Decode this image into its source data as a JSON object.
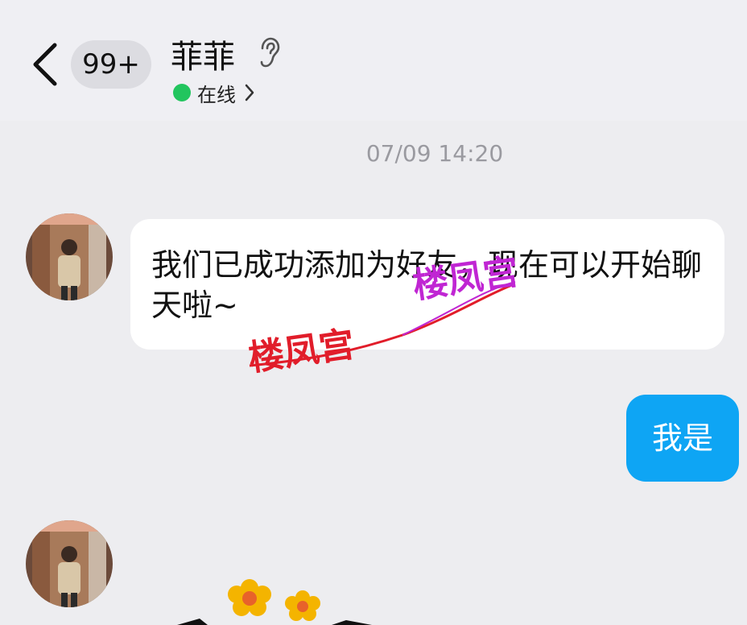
{
  "header": {
    "badge_count": "99+",
    "contact_name": "菲菲",
    "status_text": "在线",
    "status_color": "#22c55e",
    "icons": [
      "chevron-left-icon",
      "ear-icon",
      "chevron-right-icon"
    ]
  },
  "chat": {
    "timestamp": "07/09 14:20",
    "messages": [
      {
        "side": "left",
        "text": "我们已成功添加为好友，现在可以开始聊天啦~"
      },
      {
        "side": "right",
        "text": "我是"
      }
    ]
  },
  "watermark": {
    "text1": "楼凤宫",
    "text2": "楼凤宫",
    "colors": [
      "#e11d2a",
      "#c026d3"
    ]
  },
  "colors": {
    "page_bg": "#ededf0",
    "outgoing_bubble": "#0ea5f4",
    "incoming_bubble": "#ffffff"
  }
}
